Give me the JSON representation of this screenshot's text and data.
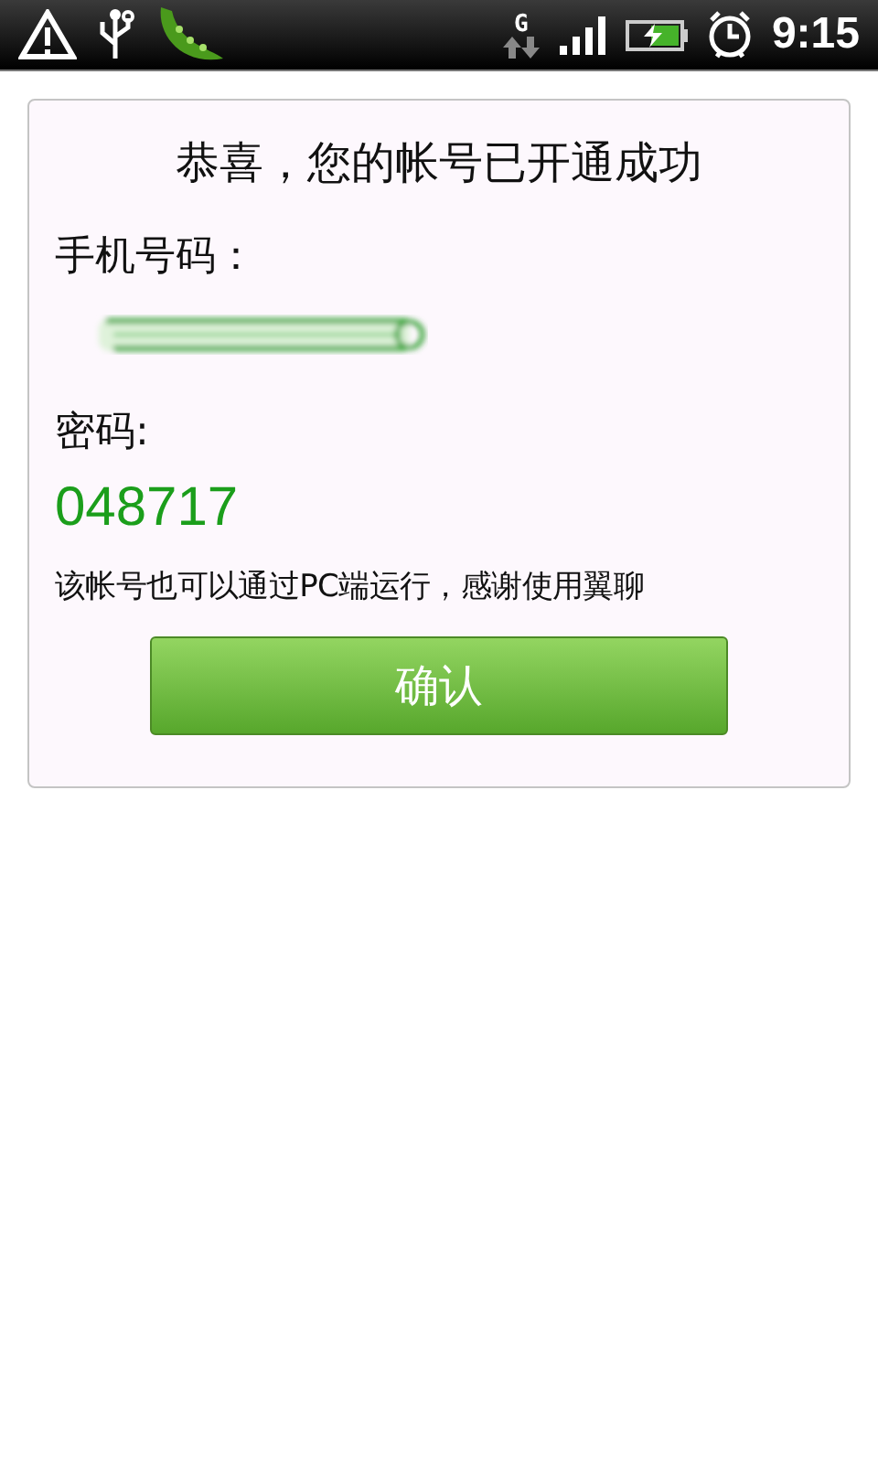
{
  "status_bar": {
    "network_type": "G",
    "time": "9:15"
  },
  "card": {
    "title": "恭喜，您的帐号已开通成功",
    "phone_label": "手机号码：",
    "password_label": "密码:",
    "password": "048717",
    "note": "该帐号也可以通过PC端运行，感谢使用翼聊",
    "confirm_button": "确认"
  }
}
